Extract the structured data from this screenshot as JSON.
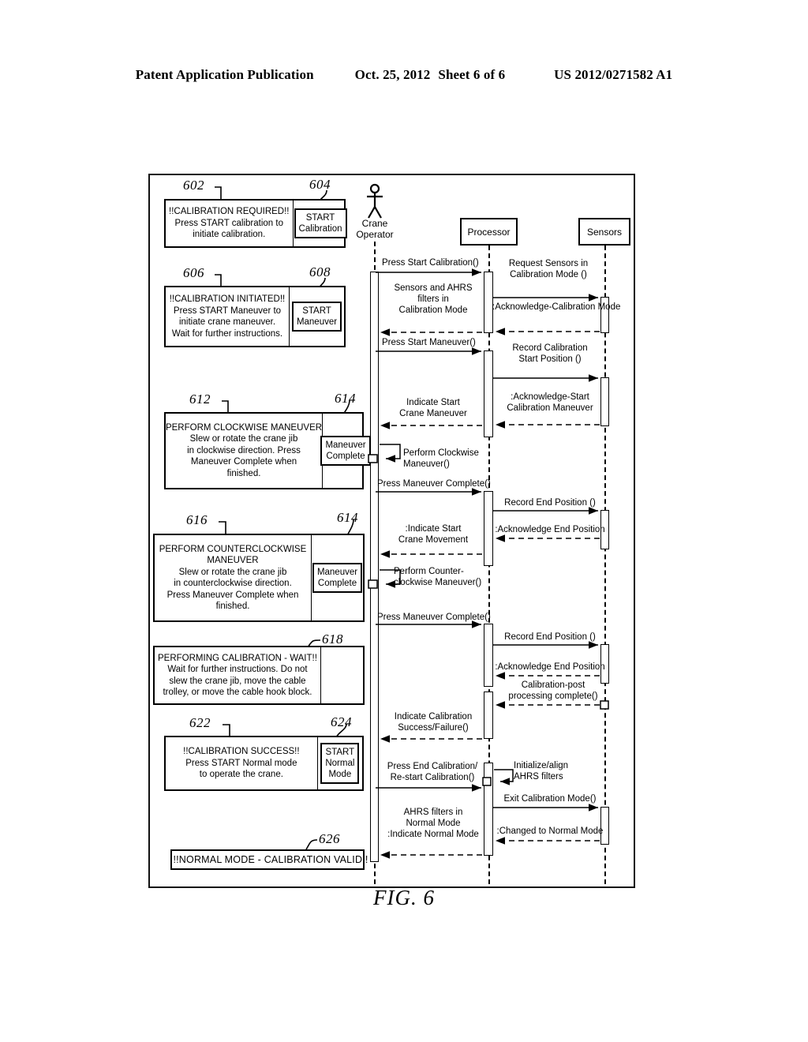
{
  "header": {
    "title": "Patent Application Publication",
    "date": "Oct. 25, 2012",
    "sheet": "Sheet 6 of 6",
    "number": "US 2012/0271582 A1"
  },
  "figure": {
    "caption": "FIG. 6"
  },
  "operator_ui_boxes": [
    {
      "ref": "602",
      "button_ref": "604",
      "lines": [
        "!!CALIBRATION REQUIRED!!",
        "Press START calibration to",
        "initiate calibration."
      ],
      "button_lines": [
        "START",
        "Calibration"
      ]
    },
    {
      "ref": "606",
      "button_ref": "608",
      "lines": [
        "!!CALIBRATION INITIATED!!",
        "Press START Maneuver to",
        "initiate crane maneuver.",
        "Wait for further instructions."
      ],
      "button_lines": [
        "START",
        "Maneuver"
      ]
    },
    {
      "ref": "612",
      "button_ref": "614",
      "lines": [
        "PERFORM CLOCKWISE MANEUVER",
        "Slew or rotate the crane jib",
        "in clockwise direction. Press",
        "Maneuver Complete when",
        "finished."
      ],
      "button_lines": [
        "Maneuver",
        "Complete"
      ]
    },
    {
      "ref": "616",
      "button_ref": "614",
      "lines": [
        "PERFORM COUNTERCLOCKWISE",
        "MANEUVER",
        "Slew or rotate the crane jib",
        "in counterclockwise direction.",
        "Press Maneuver Complete when",
        "finished."
      ],
      "button_lines": [
        "Maneuver",
        "Complete"
      ]
    },
    {
      "ref": "618",
      "button_ref": "",
      "lines": [
        "PERFORMING CALIBRATION - WAIT!!",
        "Wait for further instructions. Do not",
        "slew the crane jib, move the cable",
        "trolley, or move the cable hook block."
      ],
      "button_lines": []
    },
    {
      "ref": "622",
      "button_ref": "624",
      "lines": [
        "!!CALIBRATION SUCCESS!!",
        "Press START Normal mode",
        "to operate the crane."
      ],
      "button_lines": [
        "START",
        "Normal",
        "Mode"
      ]
    },
    {
      "ref": "626",
      "button_ref": "",
      "lines": [
        "!!NORMAL MODE - CALIBRATION VALID!!"
      ],
      "button_lines": []
    }
  ],
  "sequence": {
    "lifelines": [
      {
        "name": "Crane Operator",
        "label_lines": [
          "Crane",
          "Operator"
        ],
        "kind": "actor"
      },
      {
        "name": "Processor",
        "label_lines": [
          "Processor"
        ],
        "kind": "object"
      },
      {
        "name": "Sensors",
        "label_lines": [
          "Sensors"
        ],
        "kind": "object"
      }
    ],
    "messages": [
      {
        "id": "m1",
        "lines": [
          "Press Start Calibration()"
        ],
        "from": "Crane Operator",
        "to": "Processor",
        "style": "solid"
      },
      {
        "id": "m2",
        "lines": [
          "Request Sensors in",
          "Calibration Mode ()"
        ],
        "from": "Processor",
        "to": "Sensors",
        "style": "solid"
      },
      {
        "id": "m3",
        "lines": [
          ":Acknowledge-Calibration Mode"
        ],
        "from": "Sensors",
        "to": "Processor",
        "style": "dashed"
      },
      {
        "id": "m4",
        "lines": [
          "Sensors and AHRS",
          "filters in",
          "Calibration Mode"
        ],
        "from": "Processor",
        "to": "Crane Operator",
        "style": "dashed"
      },
      {
        "id": "m5",
        "lines": [
          "Press Start Maneuver()"
        ],
        "from": "Crane Operator",
        "to": "Processor",
        "style": "solid"
      },
      {
        "id": "m6",
        "lines": [
          "Record Calibration",
          "Start Position ()"
        ],
        "from": "Processor",
        "to": "Sensors",
        "style": "solid"
      },
      {
        "id": "m7",
        "lines": [
          ":Acknowledge-Start",
          "Calibration Maneuver"
        ],
        "from": "Sensors",
        "to": "Processor",
        "style": "dashed"
      },
      {
        "id": "m8",
        "lines": [
          "Indicate Start",
          "Crane Maneuver"
        ],
        "from": "Processor",
        "to": "Crane Operator",
        "style": "dashed"
      },
      {
        "id": "m9",
        "lines": [
          "Perform Clockwise",
          "Maneuver()"
        ],
        "from": "Crane Operator",
        "to": "Crane Operator",
        "style": "self"
      },
      {
        "id": "m10",
        "lines": [
          "Press Maneuver Complete()"
        ],
        "from": "Crane Operator",
        "to": "Processor",
        "style": "solid"
      },
      {
        "id": "m11",
        "lines": [
          "Record End Position ()"
        ],
        "from": "Processor",
        "to": "Sensors",
        "style": "solid"
      },
      {
        "id": "m12",
        "lines": [
          ":Acknowledge End Position"
        ],
        "from": "Sensors",
        "to": "Processor",
        "style": "dashed"
      },
      {
        "id": "m13",
        "lines": [
          ":Indicate Start",
          "Crane Movement"
        ],
        "from": "Processor",
        "to": "Crane Operator",
        "style": "dashed"
      },
      {
        "id": "m14",
        "lines": [
          "Perform Counter-",
          "clockwise Maneuver()"
        ],
        "from": "Crane Operator",
        "to": "Crane Operator",
        "style": "self"
      },
      {
        "id": "m15",
        "lines": [
          "Press Maneuver Complete()"
        ],
        "from": "Crane Operator",
        "to": "Processor",
        "style": "solid"
      },
      {
        "id": "m16",
        "lines": [
          "Record End Position ()"
        ],
        "from": "Processor",
        "to": "Sensors",
        "style": "solid"
      },
      {
        "id": "m17",
        "lines": [
          ":Acknowledge End Position"
        ],
        "from": "Sensors",
        "to": "Processor",
        "style": "dashed"
      },
      {
        "id": "m18",
        "lines": [
          "Calibration-post",
          "processing complete()"
        ],
        "from": "Sensors",
        "to": "Processor",
        "style": "dashed"
      },
      {
        "id": "m19",
        "lines": [
          "Indicate Calibration",
          "Success/Failure()"
        ],
        "from": "Processor",
        "to": "Crane Operator",
        "style": "dashed"
      },
      {
        "id": "m20",
        "lines": [
          "Press End Calibration/",
          "Re-start Calibration()"
        ],
        "from": "Crane Operator",
        "to": "Processor",
        "style": "solid"
      },
      {
        "id": "m21",
        "lines": [
          "Initialize/align",
          "AHRS filters"
        ],
        "from": "Processor",
        "to": "Processor",
        "style": "self"
      },
      {
        "id": "m22",
        "lines": [
          "Exit Calibration Mode()"
        ],
        "from": "Processor",
        "to": "Sensors",
        "style": "solid"
      },
      {
        "id": "m23",
        "lines": [
          ":Changed to Normal Mode"
        ],
        "from": "Sensors",
        "to": "Processor",
        "style": "dashed"
      },
      {
        "id": "m24",
        "lines": [
          "AHRS filters in",
          "Normal Mode",
          ":Indicate Normal Mode"
        ],
        "from": "Processor",
        "to": "Crane Operator",
        "style": "dashed"
      }
    ]
  }
}
